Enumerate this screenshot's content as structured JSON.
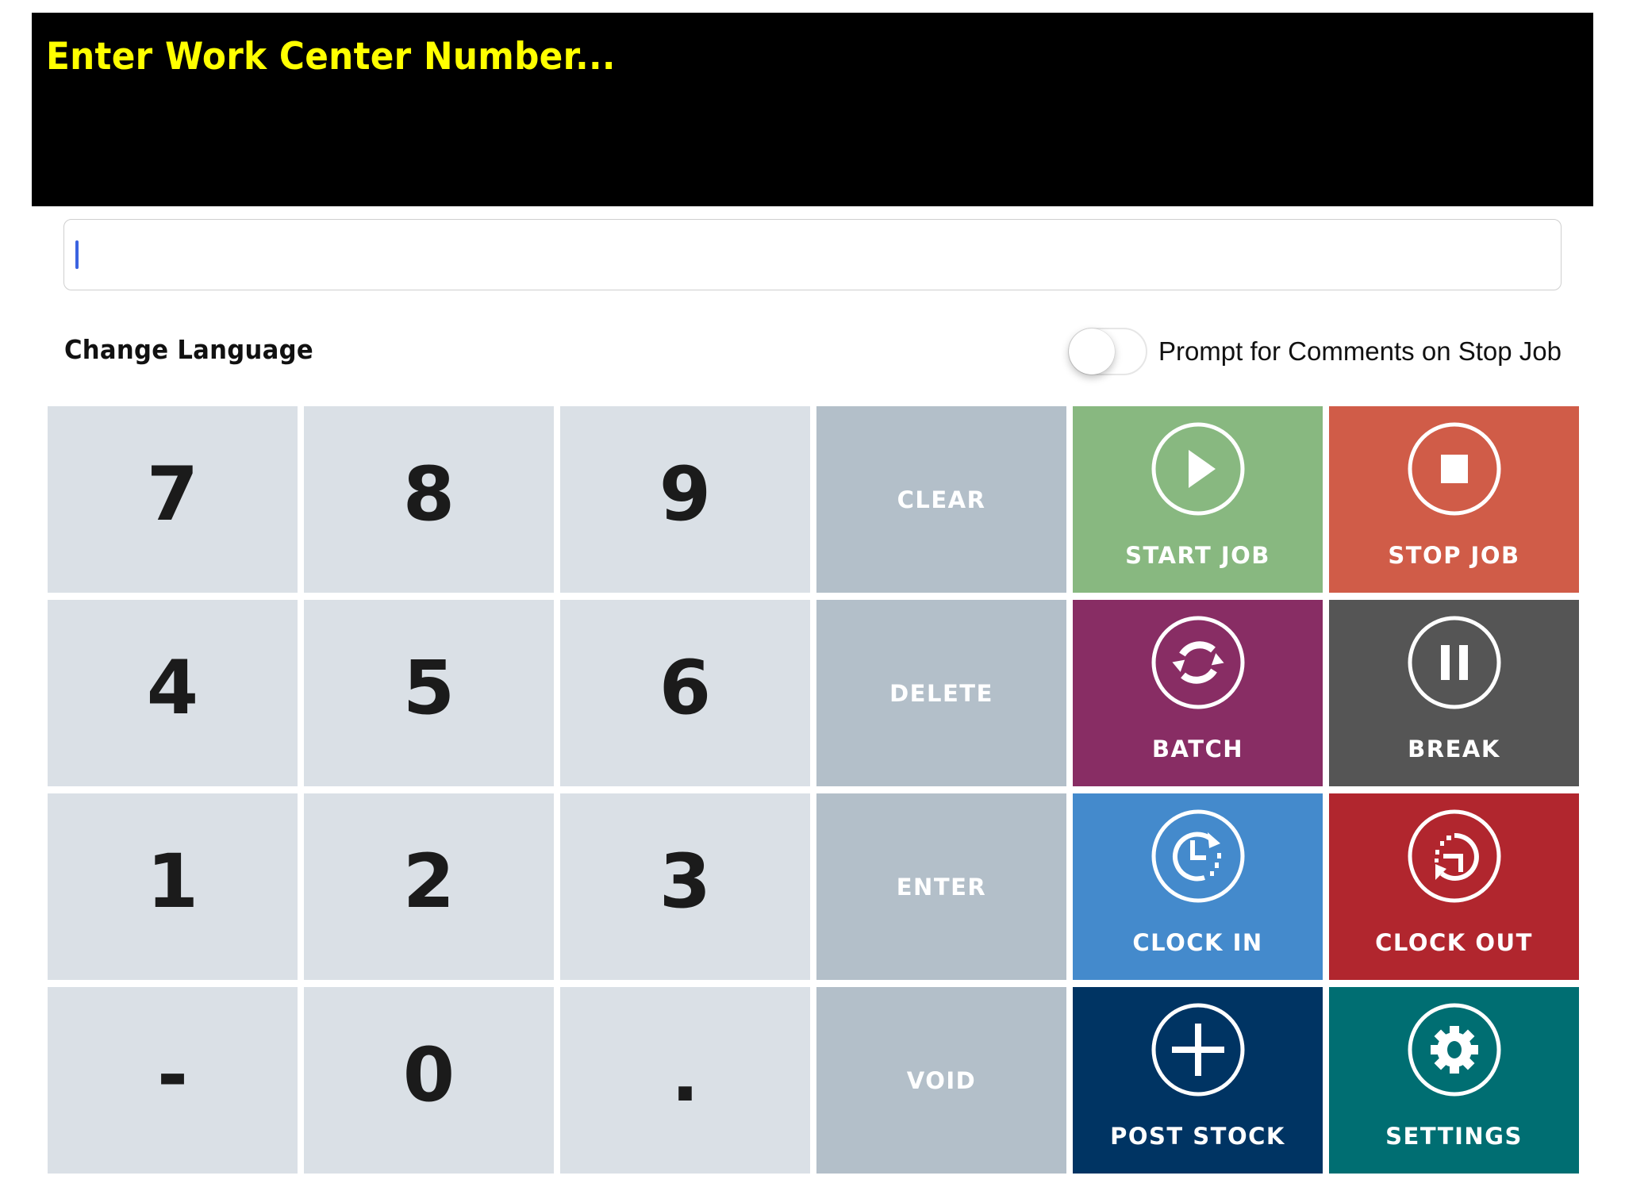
{
  "header": {
    "title": "Enter Work Center Number...",
    "background_color": "#000000",
    "title_color": "#ffff00"
  },
  "input": {
    "value": "",
    "placeholder": ""
  },
  "options": {
    "change_language_label": "Change Language",
    "prompt_toggle_label": "Prompt for Comments on Stop Job",
    "prompt_toggle_on": false
  },
  "keypad": {
    "keys": [
      {
        "label": "7",
        "type": "number"
      },
      {
        "label": "8",
        "type": "number"
      },
      {
        "label": "9",
        "type": "number"
      },
      {
        "label": "CLEAR",
        "type": "function"
      },
      {
        "label": "START JOB",
        "type": "action",
        "icon": "play-icon",
        "color": "#88b880"
      },
      {
        "label": "STOP JOB",
        "type": "action",
        "icon": "stop-icon",
        "color": "#d05c48"
      },
      {
        "label": "4",
        "type": "number"
      },
      {
        "label": "5",
        "type": "number"
      },
      {
        "label": "6",
        "type": "number"
      },
      {
        "label": "DELETE",
        "type": "function"
      },
      {
        "label": "BATCH",
        "type": "action",
        "icon": "refresh-icon",
        "color": "#882d64"
      },
      {
        "label": "BREAK",
        "type": "action",
        "icon": "pause-icon",
        "color": "#555555"
      },
      {
        "label": "1",
        "type": "number"
      },
      {
        "label": "2",
        "type": "number"
      },
      {
        "label": "3",
        "type": "number"
      },
      {
        "label": "ENTER",
        "type": "function"
      },
      {
        "label": "CLOCK IN",
        "type": "action",
        "icon": "clock-in-icon",
        "color": "#448acc"
      },
      {
        "label": "CLOCK OUT",
        "type": "action",
        "icon": "clock-out-icon",
        "color": "#b1262e"
      },
      {
        "label": "-",
        "type": "number"
      },
      {
        "label": "0",
        "type": "number"
      },
      {
        "label": ".",
        "type": "number"
      },
      {
        "label": "VOID",
        "type": "function"
      },
      {
        "label": "POST STOCK",
        "type": "action",
        "icon": "plus-icon",
        "color": "#003463"
      },
      {
        "label": "SETTINGS",
        "type": "action",
        "icon": "gear-icon",
        "color": "#006e72"
      }
    ],
    "number_key_color": "#dae0e6",
    "function_key_color": "#b3bfc9"
  }
}
